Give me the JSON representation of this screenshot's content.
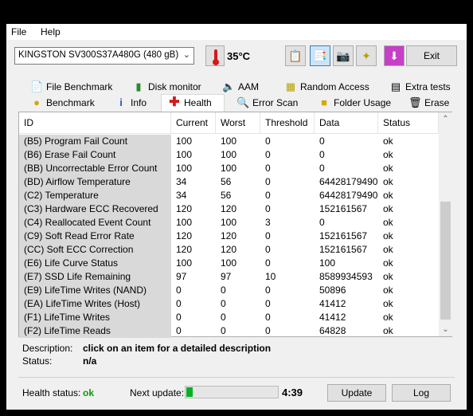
{
  "menu": {
    "file": "File",
    "help": "Help"
  },
  "drive": {
    "selected": "KINGSTON SV300S37A480G (480 gB)"
  },
  "temperature": "35°C",
  "toolbar": {
    "exit_label": "Exit"
  },
  "tabs_row1": [
    {
      "label": "File Benchmark",
      "icon": "file-benchmark-icon"
    },
    {
      "label": "Disk monitor",
      "icon": "disk-monitor-icon"
    },
    {
      "label": "AAM",
      "icon": "speaker-icon"
    },
    {
      "label": "Random Access",
      "icon": "random-access-icon"
    },
    {
      "label": "Extra tests",
      "icon": "extra-tests-icon"
    }
  ],
  "tabs_row2": [
    {
      "label": "Benchmark",
      "icon": "benchmark-icon"
    },
    {
      "label": "Info",
      "icon": "info-icon"
    },
    {
      "label": "Health",
      "icon": "health-icon"
    },
    {
      "label": "Error Scan",
      "icon": "error-scan-icon"
    },
    {
      "label": "Folder Usage",
      "icon": "folder-icon"
    },
    {
      "label": "Erase",
      "icon": "trash-icon"
    }
  ],
  "table": {
    "columns": [
      "ID",
      "Current",
      "Worst",
      "Threshold",
      "Data",
      "Status"
    ],
    "rows": [
      [
        "(B5) Program Fail Count",
        "100",
        "100",
        "0",
        "0",
        "ok"
      ],
      [
        "(B6) Erase Fail Count",
        "100",
        "100",
        "0",
        "0",
        "ok"
      ],
      [
        "(BB) Uncorrectable Error Count",
        "100",
        "100",
        "0",
        "0",
        "ok"
      ],
      [
        "(BD) Airflow Temperature",
        "34",
        "56",
        "0",
        "64428179490",
        "ok"
      ],
      [
        "(C2) Temperature",
        "34",
        "56",
        "0",
        "64428179490",
        "ok"
      ],
      [
        "(C3) Hardware ECC Recovered",
        "120",
        "120",
        "0",
        "152161567",
        "ok"
      ],
      [
        "(C4) Reallocated Event Count",
        "100",
        "100",
        "3",
        "0",
        "ok"
      ],
      [
        "(C9) Soft Read Error Rate",
        "120",
        "120",
        "0",
        "152161567",
        "ok"
      ],
      [
        "(CC) Soft ECC Correction",
        "120",
        "120",
        "0",
        "152161567",
        "ok"
      ],
      [
        "(E6) Life Curve Status",
        "100",
        "100",
        "0",
        "100",
        "ok"
      ],
      [
        "(E7) SSD Life Remaining",
        "97",
        "97",
        "10",
        "8589934593",
        "ok"
      ],
      [
        "(E9) LifeTime Writes (NAND)",
        "0",
        "0",
        "0",
        "50896",
        "ok"
      ],
      [
        "(EA) LifeTime Writes (Host)",
        "0",
        "0",
        "0",
        "41412",
        "ok"
      ],
      [
        "(F1) LifeTime Writes",
        "0",
        "0",
        "0",
        "41412",
        "ok"
      ],
      [
        "(F2) LifeTime Reads",
        "0",
        "0",
        "0",
        "64828",
        "ok"
      ]
    ]
  },
  "description": {
    "label": "Description:",
    "value": "click on an item for a detailed description"
  },
  "status": {
    "label": "Status:",
    "value": "n/a"
  },
  "footer": {
    "health_label": "Health status:",
    "health_value": "ok",
    "next_update_label": "Next update:",
    "progress_fraction": 0.07,
    "countdown": "4:39",
    "update_label": "Update",
    "log_label": "Log"
  }
}
